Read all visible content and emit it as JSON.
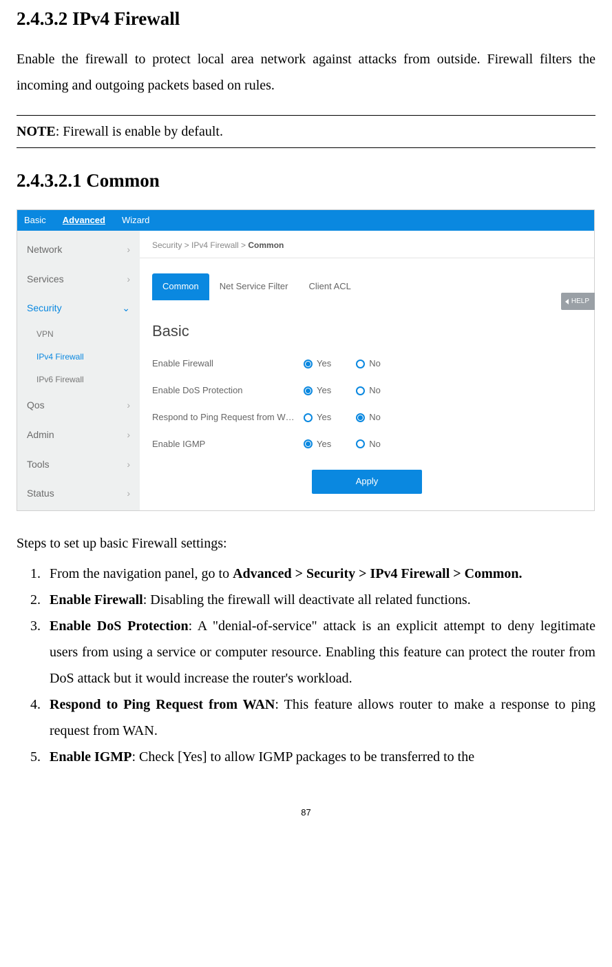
{
  "headings": {
    "h1": "2.4.3.2 IPv4 Firewall",
    "h2": "2.4.3.2.1 Common"
  },
  "intro": "Enable the firewall to protect local area network against attacks from outside. Firewall filters the incoming and outgoing packets based on rules.",
  "note": {
    "label": "NOTE",
    "text": ": Firewall is enable by default."
  },
  "ui": {
    "toptabs": [
      "Basic",
      "Advanced",
      "Wizard"
    ],
    "sidebar": {
      "items": [
        {
          "label": "Network",
          "chev": "›"
        },
        {
          "label": "Services",
          "chev": "›"
        },
        {
          "label": "Security",
          "chev": "⌄",
          "active": true
        },
        {
          "label": "Qos",
          "chev": "›"
        },
        {
          "label": "Admin",
          "chev": "›"
        },
        {
          "label": "Tools",
          "chev": "›"
        },
        {
          "label": "Status",
          "chev": "›"
        }
      ],
      "subitems": [
        {
          "label": "VPN"
        },
        {
          "label": "IPv4 Firewall",
          "active": true
        },
        {
          "label": "IPv6 Firewall"
        }
      ]
    },
    "breadcrumb": {
      "p1": "Security > IPv4 Firewall > ",
      "last": "Common"
    },
    "subtabs": [
      "Common",
      "Net Service Filter",
      "Client ACL"
    ],
    "panel_title": "Basic",
    "form": [
      {
        "label": "Enable Firewall",
        "yes": "Yes",
        "no": "No",
        "checked": "yes"
      },
      {
        "label": "Enable DoS Protection",
        "yes": "Yes",
        "no": "No",
        "checked": "yes"
      },
      {
        "label": "Respond to Ping Request from W…",
        "yes": "Yes",
        "no": "No",
        "checked": "no"
      },
      {
        "label": "Enable IGMP",
        "yes": "Yes",
        "no": "No",
        "checked": "yes"
      }
    ],
    "apply": "Apply",
    "help": "HELP"
  },
  "steps_intro": "Steps to set up basic Firewall settings:",
  "steps": [
    {
      "pre": "From the navigation panel, go to ",
      "bold": "Advanced > Security > IPv4 Firewall > Common."
    },
    {
      "bold": "Enable Firewall",
      "post": ": Disabling the firewall will deactivate all related functions."
    },
    {
      "bold": "Enable DoS Protection",
      "post": ": A \"denial-of-service\" attack is an explicit attempt to deny legitimate users from using a service or computer resource. Enabling this feature can protect the router from DoS attack but it would increase the router's workload."
    },
    {
      "bold": "Respond to Ping Request from WAN",
      "post": ": This feature allows router to make a response to ping request from WAN."
    },
    {
      "bold": "Enable IGMP",
      "post": ": Check [Yes] to allow IGMP packages to be transferred to the"
    }
  ],
  "page_number": "87"
}
